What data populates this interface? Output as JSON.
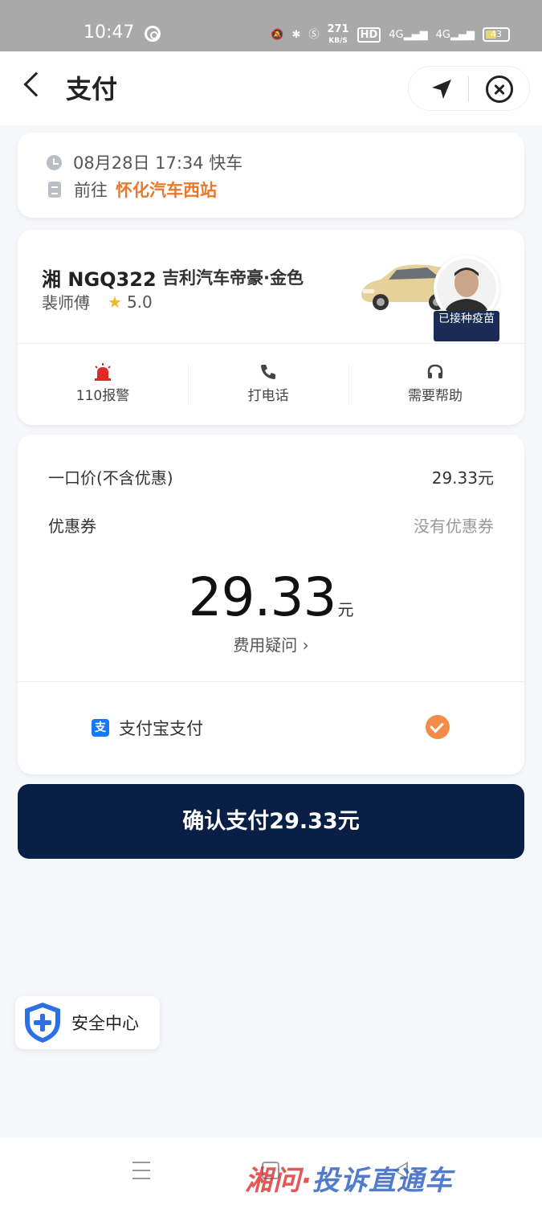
{
  "status_bar": {
    "time": "10:47",
    "net_speed_value": "271",
    "net_speed_unit": "KB/S",
    "hd_badge": "HD",
    "signal1": "4G",
    "signal2": "4G",
    "battery": "43"
  },
  "header": {
    "title": "支付"
  },
  "trip": {
    "datetime": "08月28日 17:34 快车",
    "to_label": "前往",
    "destination": "怀化汽车西站"
  },
  "driver": {
    "plate": "湘 NGQ322",
    "car_model": "吉利汽车帝豪·金色",
    "name": "裴师傅",
    "rating": "5.0",
    "vaccine_badge": "已接种疫苗"
  },
  "actions": [
    {
      "label": "110报警",
      "icon": "alarm-icon"
    },
    {
      "label": "打电话",
      "icon": "phone-icon"
    },
    {
      "label": "需要帮助",
      "icon": "headset-icon"
    }
  ],
  "payment": {
    "fixed_price_label": "一口价(不含优惠)",
    "fixed_price_value": "29.33元",
    "coupon_label": "优惠券",
    "coupon_value": "没有优惠券",
    "total_amount": "29.33",
    "total_unit": "元",
    "fee_question": "费用疑问 ›",
    "method_label": "支付宝支付",
    "method_icon_char": "支"
  },
  "confirm_button": "确认支付29.33元",
  "safety_center": "安全中心",
  "watermark": {
    "part1": "湘问·",
    "part2": "投诉直通车"
  },
  "colors": {
    "accent_orange": "#e8782b",
    "pay_button": "#0a1f45",
    "check": "#f28c48",
    "alipay": "#1677ff"
  }
}
